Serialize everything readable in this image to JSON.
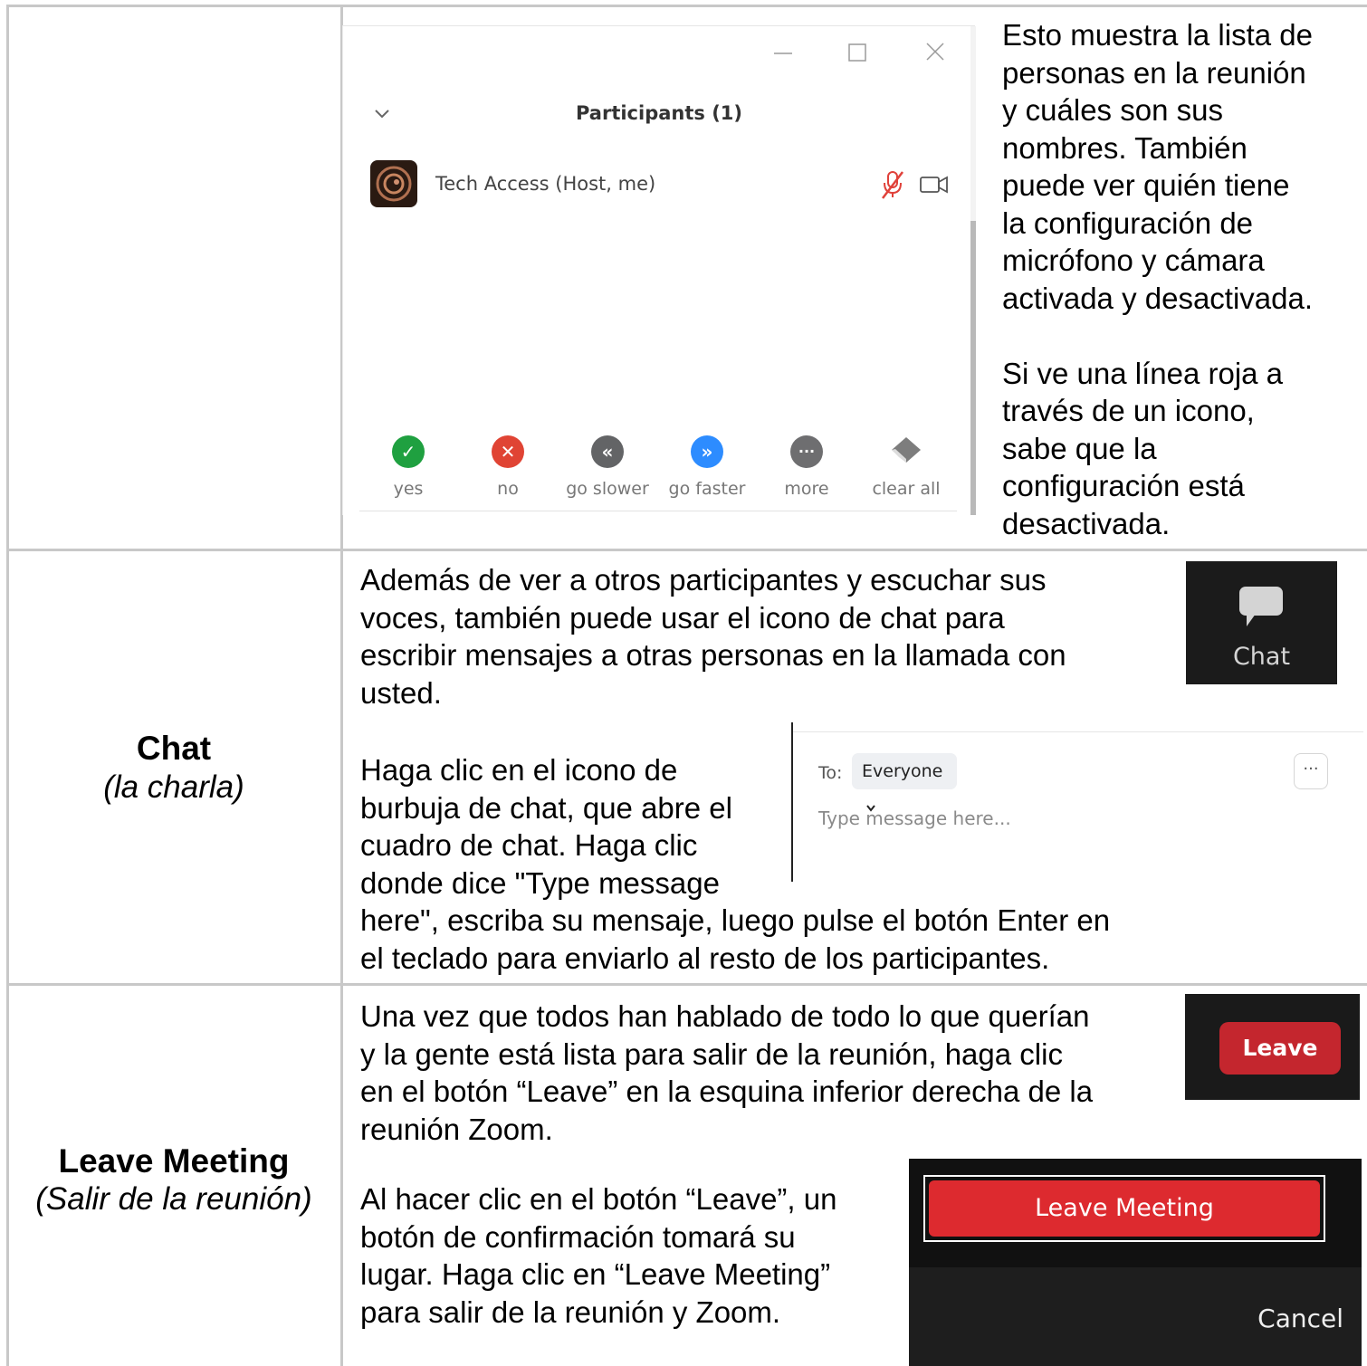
{
  "participants_window": {
    "title": "Participants (1)",
    "participant_name": "Tech Access (Host, me)",
    "reactions": [
      {
        "label": "yes",
        "glyph": "✓",
        "color": "#1fa040"
      },
      {
        "label": "no",
        "glyph": "✕",
        "color": "#e04434"
      },
      {
        "label": "go slower",
        "glyph": "«",
        "color": "#636466"
      },
      {
        "label": "go faster",
        "glyph": "»",
        "color": "#2d8cff"
      },
      {
        "label": "more",
        "glyph": "···",
        "color": "#6e6e70"
      },
      {
        "label": "clear all",
        "glyph": "",
        "color": "#7d7d7d"
      }
    ]
  },
  "row1": {
    "description_lines": [
      "Esto muestra la lista de",
      "personas en la reunión",
      "y cuáles son sus",
      "nombres. También",
      "puede ver quién tiene",
      "la configuración de",
      "micrófono y cámara",
      "activada y desactivada.",
      "",
      "Si ve una línea roja a",
      "través de un icono,",
      "sabe que la",
      "configuración está",
      "desactivada."
    ]
  },
  "row2": {
    "title": "Chat",
    "subtitle": "(la charla)",
    "para1_lines": [
      "Además de ver a otros participantes y escuchar sus",
      "voces, también puede usar el icono de chat para",
      "escribir mensajes a otras personas en la llamada con",
      "usted."
    ],
    "para2_lines": [
      "Haga clic en el icono de",
      "burbuja de chat, que abre el",
      "cuadro de chat. Haga clic",
      "donde dice \"Type message",
      "here\", escriba su mensaje, luego pulse el botón Enter en",
      "el teclado para enviarlo al resto de los participantes."
    ],
    "chat_icon_label": "Chat",
    "chatbox": {
      "to_label": "To:",
      "recipient": "Everyone",
      "placeholder": "Type message here...",
      "more": "···"
    }
  },
  "row3": {
    "title": "Leave Meeting",
    "subtitle": "(Salir de la reunión)",
    "para1_lines": [
      "Una vez que todos han hablado de todo lo que querían",
      "y la gente está lista para salir de la reunión, haga clic",
      "en el botón “Leave” en la esquina inferior derecha de la",
      "reunión Zoom."
    ],
    "para2_lines": [
      "Al hacer clic en el botón “Leave”, un",
      "botón de confirmación tomará su",
      "lugar. Haga clic en “Leave Meeting”",
      "para salir de la reunión y Zoom."
    ],
    "leave_label": "Leave",
    "leave_meeting_label": "Leave Meeting",
    "cancel_label": "Cancel"
  },
  "colors": {
    "grid_line": "#c8c8c8",
    "zoom_red": "#dd2a2f",
    "dark_tile": "#1b1b1b"
  }
}
